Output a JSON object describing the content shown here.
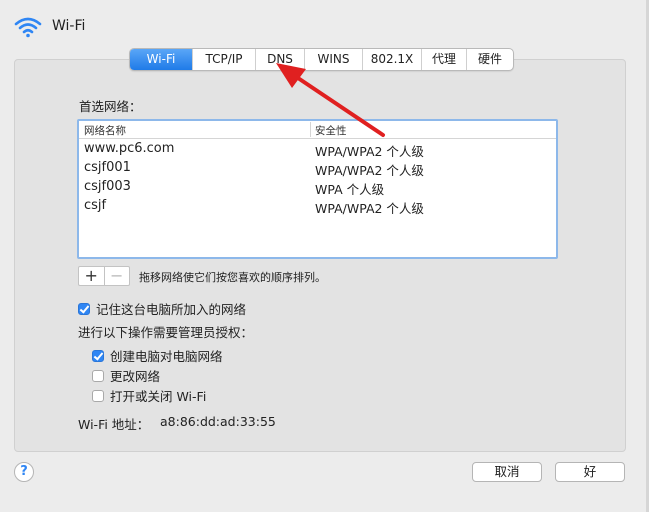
{
  "header": {
    "title": "Wi-Fi",
    "icon": "wifi-icon"
  },
  "tabs": [
    {
      "label": "Wi-Fi",
      "active": true
    },
    {
      "label": "TCP/IP",
      "active": false
    },
    {
      "label": "DNS",
      "active": false
    },
    {
      "label": "WINS",
      "active": false
    },
    {
      "label": "802.1X",
      "active": false
    },
    {
      "label": "代理",
      "active": false
    },
    {
      "label": "硬件",
      "active": false
    }
  ],
  "preferred_networks": {
    "label": "首选网络：",
    "columns": {
      "name": "网络名称",
      "security": "安全性"
    },
    "rows": [
      {
        "name": "www.pc6.com",
        "security": "WPA/WPA2 个人级"
      },
      {
        "name": "csjf001",
        "security": "WPA/WPA2 个人级"
      },
      {
        "name": "csjf003",
        "security": "WPA 个人级"
      },
      {
        "name": "csjf",
        "security": "WPA/WPA2 个人级"
      }
    ],
    "add_label": "+",
    "remove_label": "−",
    "drag_note": "拖移网络使它们按您喜欢的顺序排列。"
  },
  "options": {
    "remember": {
      "label": "记住这台电脑所加入的网络",
      "checked": true
    },
    "admin_label": "进行以下操作需要管理员授权：",
    "create": {
      "label": "创建电脑对电脑网络",
      "checked": true
    },
    "change": {
      "label": "更改网络",
      "checked": false
    },
    "toggle": {
      "label": "打开或关闭 Wi-Fi",
      "checked": false
    }
  },
  "address": {
    "label": "Wi-Fi 地址：",
    "value": "a8:86:dd:ad:33:55"
  },
  "footer": {
    "help_label": "?",
    "cancel_label": "取消",
    "ok_label": "好"
  },
  "colors": {
    "accent": "#2f86f4",
    "arrow": "#e02020",
    "table_focus": "#8db8ea"
  }
}
